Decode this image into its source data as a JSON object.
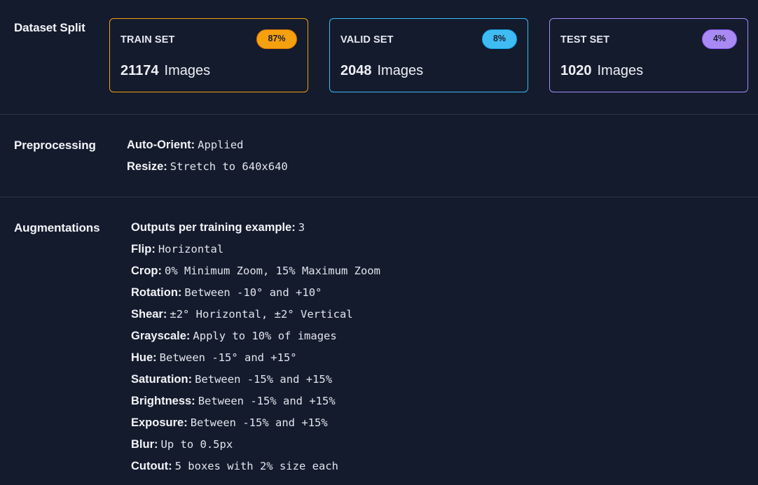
{
  "dataset_split": {
    "title": "Dataset Split",
    "cards": [
      {
        "label": "TRAIN SET",
        "percent": "87%",
        "count": "21174",
        "unit": "Images",
        "accent": "#f59e0b",
        "badge_fill": "#f5a00f"
      },
      {
        "label": "VALID SET",
        "percent": "8%",
        "count": "2048",
        "unit": "Images",
        "accent": "#38bdf8",
        "badge_fill": "#3fbcf3"
      },
      {
        "label": "TEST SET",
        "percent": "4%",
        "count": "1020",
        "unit": "Images",
        "accent": "#a78bfa",
        "badge_fill": "#a98af5"
      }
    ]
  },
  "preprocessing": {
    "title": "Preprocessing",
    "items": [
      {
        "key": "Auto-Orient:",
        "value": "Applied"
      },
      {
        "key": "Resize:",
        "value": "Stretch to 640x640"
      }
    ]
  },
  "augmentations": {
    "title": "Augmentations",
    "items": [
      {
        "key": "Outputs per training example:",
        "value": "3"
      },
      {
        "key": "Flip:",
        "value": "Horizontal"
      },
      {
        "key": "Crop:",
        "value": "0% Minimum Zoom, 15% Maximum Zoom"
      },
      {
        "key": "Rotation:",
        "value": "Between -10° and +10°"
      },
      {
        "key": "Shear:",
        "value": "±2° Horizontal, ±2° Vertical"
      },
      {
        "key": "Grayscale:",
        "value": "Apply to 10% of images"
      },
      {
        "key": "Hue:",
        "value": "Between -15° and +15°"
      },
      {
        "key": "Saturation:",
        "value": "Between -15% and +15%"
      },
      {
        "key": "Brightness:",
        "value": "Between -15% and +15%"
      },
      {
        "key": "Exposure:",
        "value": "Between -15% and +15%"
      },
      {
        "key": "Blur:",
        "value": "Up to 0.5px"
      },
      {
        "key": "Cutout:",
        "value": "5 boxes with 2% size each"
      }
    ]
  }
}
